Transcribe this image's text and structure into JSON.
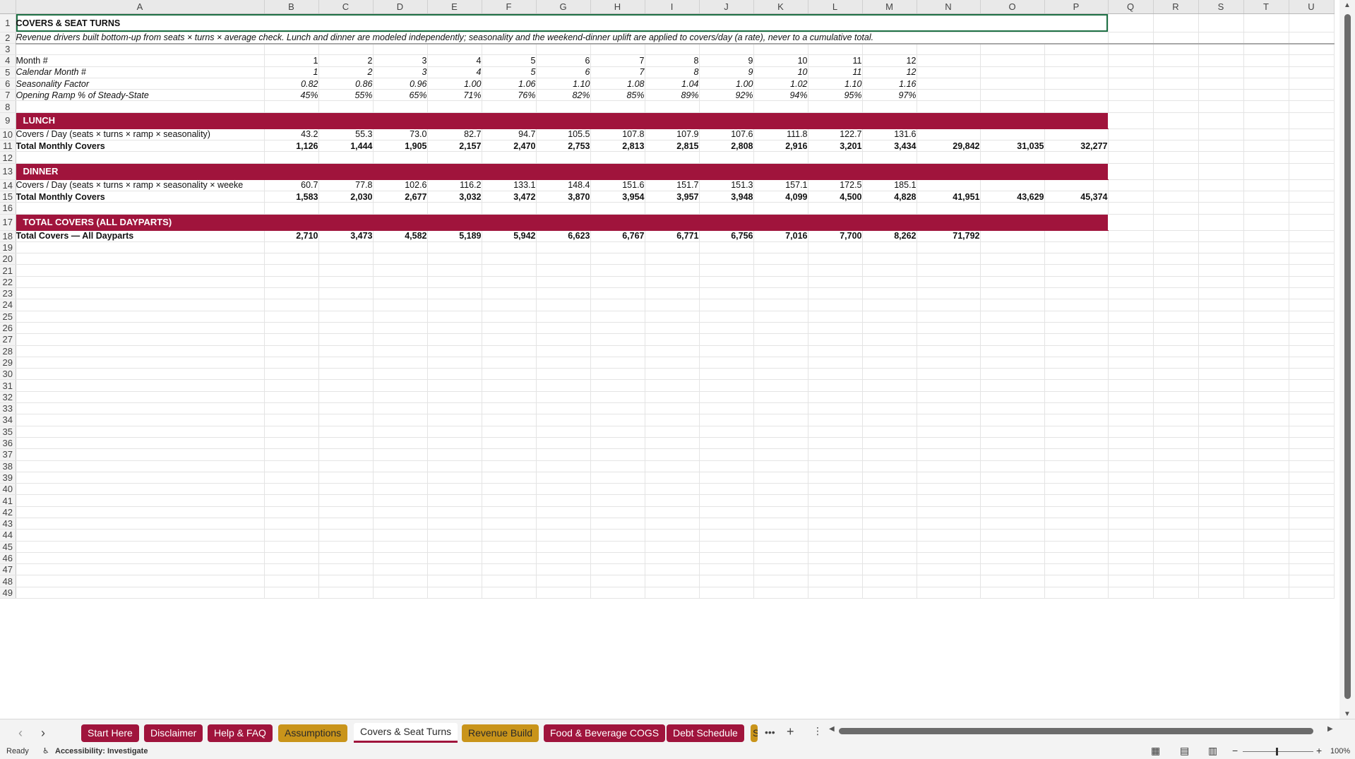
{
  "columns": [
    "A",
    "B",
    "C",
    "D",
    "E",
    "F",
    "G",
    "H",
    "I",
    "J",
    "K",
    "L",
    "M",
    "N",
    "O",
    "P",
    "Q",
    "R",
    "S",
    "T",
    "U"
  ],
  "title": "COVERS & SEAT TURNS",
  "note": "Revenue drivers built bottom-up from seats × turns × average check. Lunch and dinner are modeled independently; seasonality and the weekend-dinner uplift are applied to covers/day (a rate), never to a cumulative total.",
  "rows": {
    "month": {
      "label": "Month #",
      "values": [
        "1",
        "2",
        "3",
        "4",
        "5",
        "6",
        "7",
        "8",
        "9",
        "10",
        "11",
        "12"
      ]
    },
    "calendar": {
      "label": "Calendar Month #",
      "values": [
        "1",
        "2",
        "3",
        "4",
        "5",
        "6",
        "7",
        "8",
        "9",
        "10",
        "11",
        "12"
      ]
    },
    "seasonality": {
      "label": "Seasonality Factor",
      "values": [
        "0.82",
        "0.86",
        "0.96",
        "1.00",
        "1.06",
        "1.10",
        "1.08",
        "1.04",
        "1.00",
        "1.02",
        "1.10",
        "1.16"
      ]
    },
    "ramp": {
      "label": "Opening Ramp % of Steady-State",
      "values": [
        "45%",
        "55%",
        "65%",
        "71%",
        "76%",
        "82%",
        "85%",
        "89%",
        "92%",
        "94%",
        "95%",
        "97%"
      ]
    },
    "lunch_band": {
      "label": "LUNCH"
    },
    "lunch_day": {
      "label": "Covers / Day (seats × turns × ramp × seasonality)",
      "values": [
        "43.2",
        "55.3",
        "73.0",
        "82.7",
        "94.7",
        "105.5",
        "107.8",
        "107.9",
        "107.6",
        "111.8",
        "122.7",
        "131.6"
      ]
    },
    "lunch_total": {
      "label": "Total Monthly Covers",
      "values": [
        "1,126",
        "1,444",
        "1,905",
        "2,157",
        "2,470",
        "2,753",
        "2,813",
        "2,815",
        "2,808",
        "2,916",
        "3,201",
        "3,434"
      ],
      "n": "29,842",
      "o": "31,035",
      "p": "32,277"
    },
    "dinner_band": {
      "label": "DINNER"
    },
    "dinner_day": {
      "label": "Covers / Day (seats × turns × ramp × seasonality × weeke",
      "values": [
        "60.7",
        "77.8",
        "102.6",
        "116.2",
        "133.1",
        "148.4",
        "151.6",
        "151.7",
        "151.3",
        "157.1",
        "172.5",
        "185.1"
      ]
    },
    "dinner_total": {
      "label": "Total Monthly Covers",
      "values": [
        "1,583",
        "2,030",
        "2,677",
        "3,032",
        "3,472",
        "3,870",
        "3,954",
        "3,957",
        "3,948",
        "4,099",
        "4,500",
        "4,828"
      ],
      "n": "41,951",
      "o": "43,629",
      "p": "45,374"
    },
    "all_band": {
      "label": "TOTAL COVERS (ALL DAYPARTS)"
    },
    "all_total": {
      "label": "Total Covers — All Dayparts",
      "values": [
        "2,710",
        "3,473",
        "4,582",
        "5,189",
        "5,942",
        "6,623",
        "6,767",
        "6,771",
        "6,756",
        "7,016",
        "7,700",
        "8,262"
      ],
      "n": "71,792"
    }
  },
  "tabs": [
    {
      "label": "Start Here",
      "style": "red"
    },
    {
      "label": "Disclaimer",
      "style": "red"
    },
    {
      "label": "Help & FAQ",
      "style": "red"
    },
    {
      "label": "Assumptions",
      "style": "gold"
    },
    {
      "label": "Covers & Seat Turns",
      "style": "active"
    },
    {
      "label": "Revenue Build",
      "style": "gold"
    },
    {
      "label": "Food & Beverage COGS",
      "style": "red"
    },
    {
      "label": "Debt Schedule",
      "style": "red"
    },
    {
      "label": "S",
      "style": "gold"
    }
  ],
  "status": {
    "ready": "Ready",
    "accessibility": "Accessibility: Investigate",
    "zoom": "100%"
  },
  "colors": {
    "band": "#a0143c",
    "gold": "#c9941a"
  }
}
